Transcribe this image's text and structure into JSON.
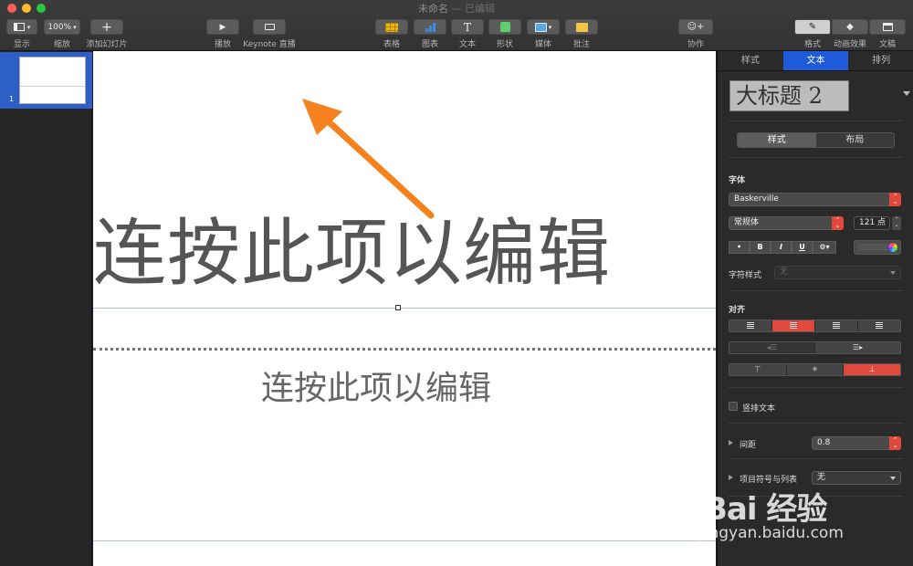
{
  "window": {
    "title": "未命名",
    "separator": "—",
    "status": "已编辑"
  },
  "toolbar": {
    "view_label": "显示",
    "zoom_value": "100%",
    "zoom_label": "缩放",
    "add_slide_label": "添加幻灯片",
    "play_label": "播放",
    "keynote_live_label": "Keynote 直播",
    "table_label": "表格",
    "chart_label": "图表",
    "text_label": "文本",
    "shape_label": "形状",
    "media_label": "媒体",
    "comment_label": "批注",
    "collaborate_label": "协作",
    "format_label": "格式",
    "animate_label": "动画效果",
    "document_label": "文稿"
  },
  "navigator": {
    "slide_number": "1"
  },
  "slide": {
    "title_text": "连按此项以编辑",
    "body_text": "连按此项以编辑"
  },
  "inspector": {
    "tabs": [
      "样式",
      "文本",
      "排列"
    ],
    "active_tab": "文本",
    "paragraph_style": "大标题 2",
    "style_layout_tabs": [
      "样式",
      "布局"
    ],
    "font_section_label": "字体",
    "font_family": "Baskerville",
    "font_typeface": "常规体",
    "font_size": "121 点",
    "format_buttons": [
      "•",
      "B",
      "I",
      "U"
    ],
    "char_style_label": "字符样式",
    "char_style_value": "无",
    "align_section_label": "对齐",
    "vertical_text_label": "竖排文本",
    "spacing_label": "间距",
    "spacing_value": "0.8",
    "bullets_label": "项目符号与列表",
    "bullets_value": "无"
  },
  "watermark": {
    "brand": "Bai 经验",
    "url": "jingyan.baidu.com"
  },
  "colors": {
    "accent_blue": "#1e5bd8",
    "accent_red": "#e14a3b",
    "arrow_orange": "#f5821f"
  }
}
